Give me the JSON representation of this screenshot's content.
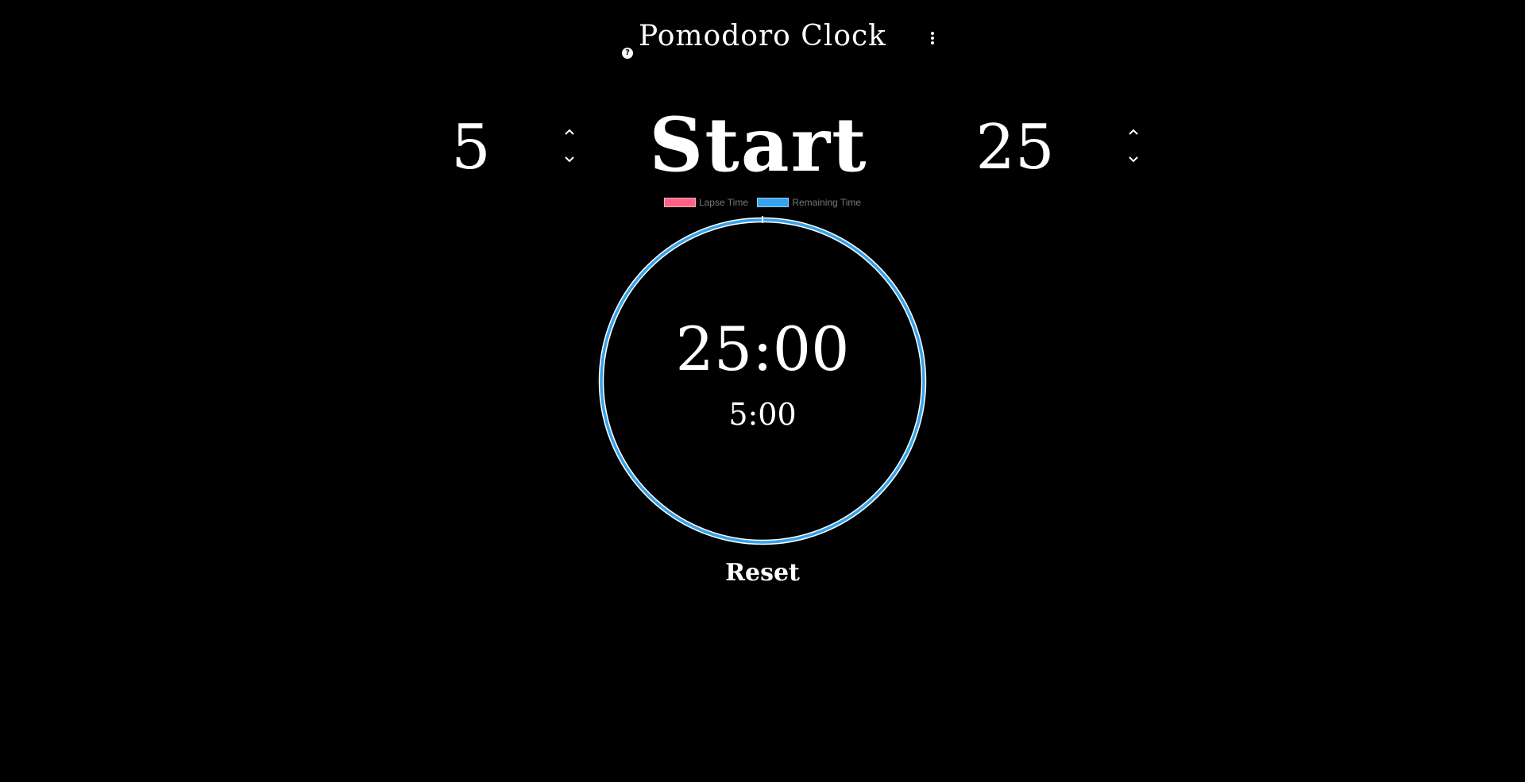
{
  "app": {
    "title": "Pomodoro Clock",
    "help_icon_glyph": "?",
    "help_icon": "help-icon",
    "menu_icon": "more-vertical-icon"
  },
  "settings": {
    "break_length": "5",
    "session_length": "25",
    "increment_icon": "chevron-up-icon",
    "decrement_icon": "chevron-down-icon"
  },
  "controls": {
    "start_label": "Start",
    "reset_label": "Reset"
  },
  "legend": {
    "lapse_label": "Lapse Time",
    "lapse_color": "#ff6384",
    "remaining_label": "Remaining Time",
    "remaining_color": "#36a2eb"
  },
  "clock": {
    "session_time": "25:00",
    "break_time": "5:00",
    "lapse_fraction": 0,
    "remaining_fraction": 1
  },
  "colors": {
    "background": "#000000",
    "text": "#ffffff",
    "legend_text": "#777777"
  }
}
